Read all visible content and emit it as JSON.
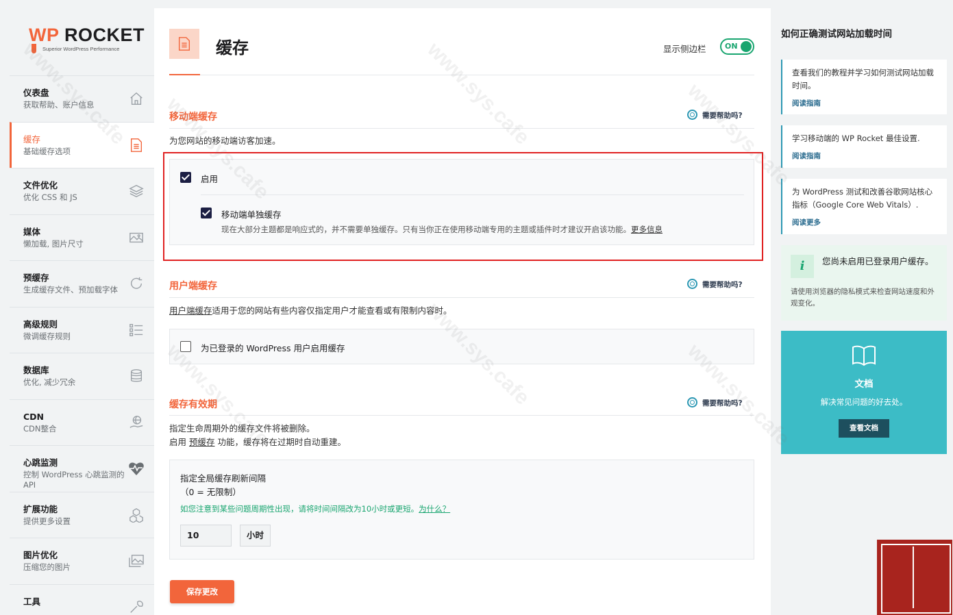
{
  "logo": {
    "brand_wp": "WP",
    "brand_rest": " ROCKET",
    "tagline": "Superior WordPress Performance"
  },
  "nav": [
    {
      "title": "仪表盘",
      "sub": "获取帮助、账户信息",
      "icon": "home-icon"
    },
    {
      "title": "缓存",
      "sub": "基础缓存选项",
      "icon": "document-icon"
    },
    {
      "title": "文件优化",
      "sub": "优化 CSS 和 JS",
      "icon": "layers-icon"
    },
    {
      "title": "媒体",
      "sub": "懒加载, 图片尺寸",
      "icon": "image-icon"
    },
    {
      "title": "预缓存",
      "sub": "生成缓存文件、预加载字体",
      "icon": "refresh-icon"
    },
    {
      "title": "高级规则",
      "sub": "微调缓存规则",
      "icon": "list-icon"
    },
    {
      "title": "数据库",
      "sub": "优化, 减少冗余",
      "icon": "database-icon"
    },
    {
      "title": "CDN",
      "sub": "CDN整合",
      "icon": "globe-hand-icon"
    },
    {
      "title": "心跳监测",
      "sub": "控制 WordPress 心跳监测的 API",
      "icon": "heartbeat-icon"
    },
    {
      "title": "扩展功能",
      "sub": "提供更多设置",
      "icon": "cubes-icon"
    },
    {
      "title": "图片优化",
      "sub": "压缩您的图片",
      "icon": "images-icon"
    },
    {
      "title": "工具",
      "sub": "",
      "icon": "tools-icon"
    }
  ],
  "header": {
    "title": "缓存",
    "sidebar_toggle_label": "显示侧边栏",
    "toggle_state": "ON"
  },
  "help_label": "需要帮助吗?",
  "mobile": {
    "title": "移动端缓存",
    "desc": "为您网站的移动端访客加速。",
    "enable_label": "启用",
    "separate_label": "移动端单独缓存",
    "separate_note": "现在大部分主题都是响应式的，并不需要单独缓存。只有当你正在使用移动端专用的主题或插件时才建议开启该功能。",
    "more_info": "更多信息"
  },
  "user": {
    "title": "用户端缓存",
    "desc_link": "用户端缓存",
    "desc_rest": "适用于您的网站有些内容仅指定用户才能查看或有限制内容时。",
    "checkbox_label": "为已登录的 WordPress 用户启用缓存"
  },
  "lifespan": {
    "title": "缓存有效期",
    "desc1": "指定生命周期外的缓存文件将被删除。",
    "desc2_pre": "启用 ",
    "desc2_link": "预缓存",
    "desc2_post": " 功能，缓存将在过期时自动重建。",
    "field_label": "指定全局缓存刷新间隔",
    "field_hint": "（0 = 无限制）",
    "green_note": "如您注意到某些问题周期性出现，请将时间间隔改为10小时或更短。",
    "why_link": "为什么？",
    "value": "10",
    "unit": "小时"
  },
  "save_button": "保存更改",
  "right": {
    "title": "如何正确测试网站加载时间",
    "cards": [
      {
        "text": "查看我们的教程并学习如何测试网站加载时间。",
        "link": "阅读指南"
      },
      {
        "text": "学习移动端的 WP Rocket 最佳设置.",
        "link": "阅读指南"
      },
      {
        "text": "为 WordPress 测试和改善谷歌网站核心指标（Google Core Web Vitals）.",
        "link": "阅读更多"
      }
    ],
    "info": {
      "icon": "i",
      "title": "您尚未启用已登录用户缓存。",
      "desc": "请使用浏览器的隐私模式来检查网站速度和外观变化。"
    },
    "docs": {
      "title": "文档",
      "sub": "解决常见问题的好去处。",
      "button": "查看文档"
    }
  },
  "watermark": "www.sys.cafe",
  "colors": {
    "accent": "#f2653b",
    "green": "#18a56f",
    "teal": "#3cbcc6",
    "navy": "#1c1f43"
  }
}
